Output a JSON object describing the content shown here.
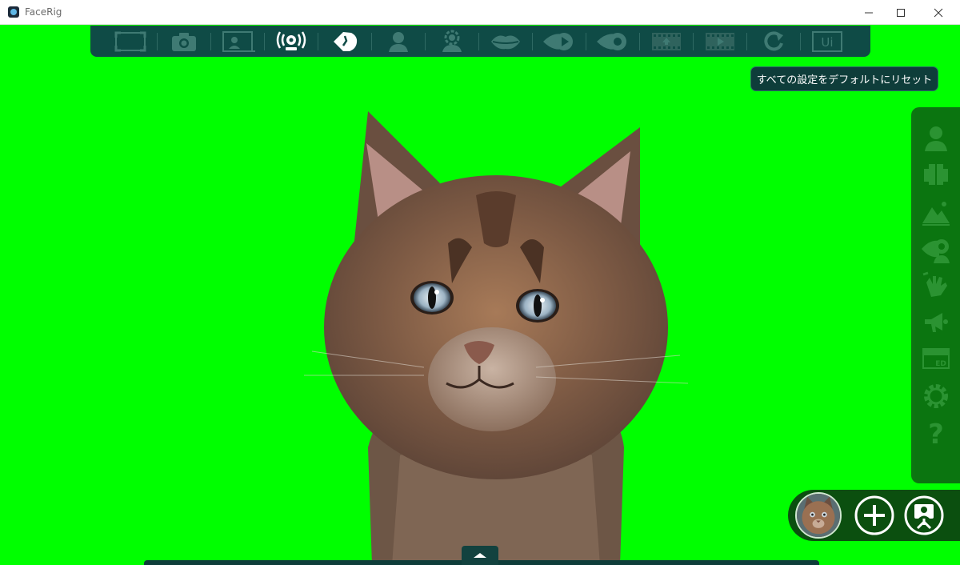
{
  "window": {
    "title": "FaceRig",
    "controls": [
      "minimize",
      "maximize",
      "close"
    ]
  },
  "toolbar": {
    "items": [
      {
        "name": "fullscreen-icon"
      },
      {
        "name": "camera-icon"
      },
      {
        "name": "broadcast-frame-icon"
      },
      {
        "name": "webcam-tracking-icon"
      },
      {
        "name": "face-calibrate-icon"
      },
      {
        "name": "avatar-user-icon"
      },
      {
        "name": "avatar-settings-icon"
      },
      {
        "name": "lips-icon"
      },
      {
        "name": "eye-play-icon"
      },
      {
        "name": "eye-record-icon"
      },
      {
        "name": "film-upload-icon"
      },
      {
        "name": "film-play-icon"
      },
      {
        "name": "reset-icon"
      },
      {
        "name": "ui-toggle-icon",
        "label": "Ui"
      }
    ]
  },
  "tooltip": {
    "text": "すべての設定をデフォルトにリセット"
  },
  "sidebar": {
    "items": [
      {
        "name": "avatar-icon"
      },
      {
        "name": "environment-icon"
      },
      {
        "name": "mountain-icon"
      },
      {
        "name": "camera-tracking-icon"
      },
      {
        "name": "hand-icon"
      },
      {
        "name": "megaphone-icon"
      },
      {
        "name": "ed-screen-icon",
        "label": "ED"
      },
      {
        "name": "gear-icon"
      },
      {
        "name": "help-icon",
        "label": "?"
      }
    ]
  },
  "controls": {
    "add_label": "+"
  },
  "colors": {
    "chroma_green": "#00ff00",
    "toolbar_bg": "#0f4b46",
    "tooltip_bg": "#0e3d3a",
    "sidebar_bg": "#0d6a12",
    "icon_color": "#3f7a73",
    "active_icon": "#ffffff"
  }
}
